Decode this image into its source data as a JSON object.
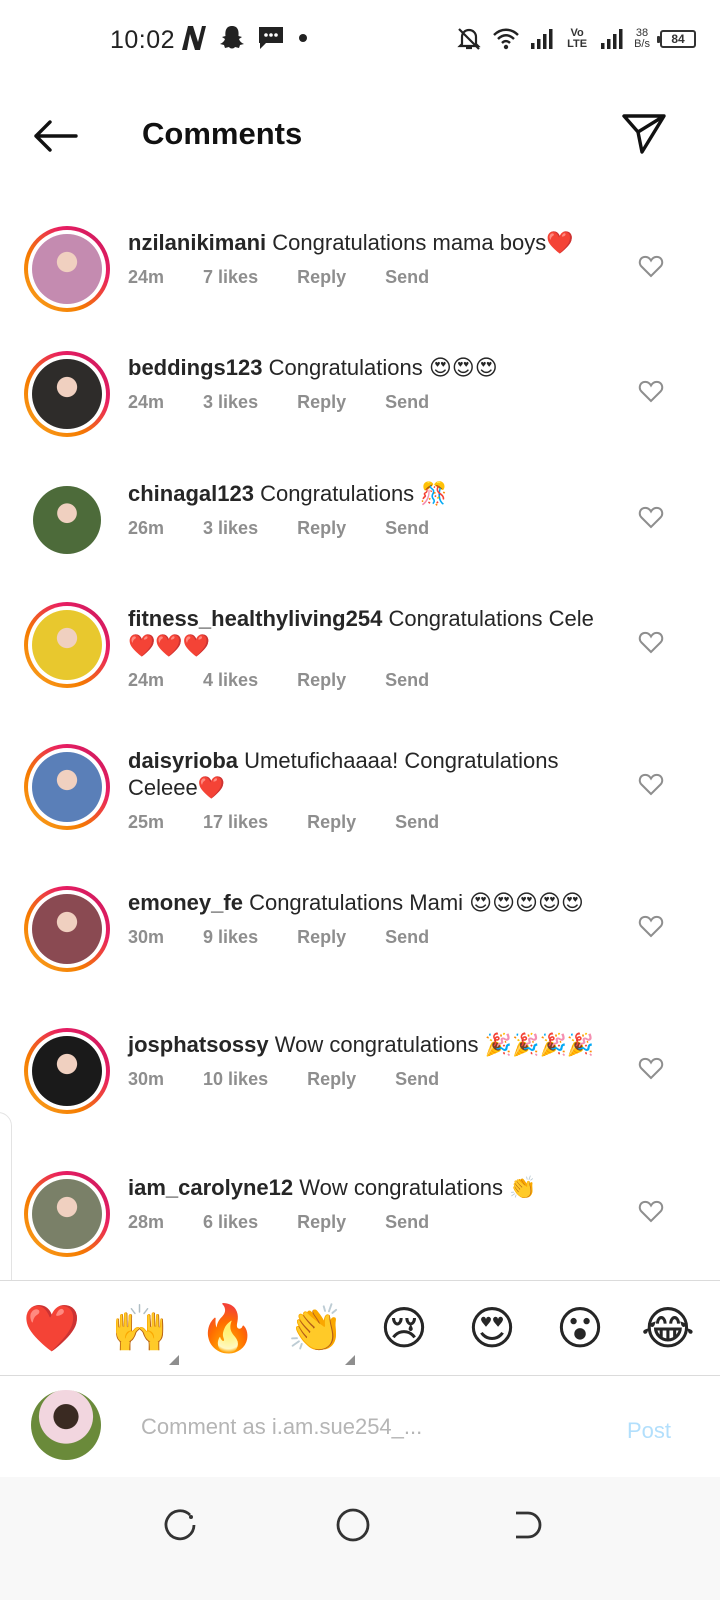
{
  "status_bar": {
    "time": "10:02",
    "net_speed_value": "38",
    "net_speed_unit": "B/s",
    "network_label": "Vo LTE",
    "battery": "84",
    "left_icons": [
      "netflix-icon",
      "snapchat-icon",
      "message-icon",
      "dot-icon"
    ],
    "right_icons": [
      "mute-bell-icon",
      "wifi-icon",
      "signal-icon",
      "signal-icon",
      "battery-icon"
    ]
  },
  "header": {
    "title": "Comments",
    "back_icon": "arrow-left-icon",
    "share_icon": "paper-plane-icon"
  },
  "comments": [
    {
      "username": "nzilanikimani",
      "text": "Congratulations mama boys❤️",
      "time": "24m",
      "likes": "7 likes",
      "reply": "Reply",
      "send": "Send",
      "story_ring": true,
      "avatar_color": "#c48bb0"
    },
    {
      "username": "beddings123",
      "text": "Congratulations 😍😍😍",
      "time": "24m",
      "likes": "3 likes",
      "reply": "Reply",
      "send": "Send",
      "story_ring": true,
      "avatar_color": "#2e2c2a"
    },
    {
      "username": "chinagal123",
      "text": "Congratulations 🎊",
      "time": "26m",
      "likes": "3 likes",
      "reply": "Reply",
      "send": "Send",
      "story_ring": false,
      "avatar_color": "#4d6b3a"
    },
    {
      "username": "fitness_healthyliving254",
      "text": "Congratulations Cele ❤️❤️❤️",
      "time": "24m",
      "likes": "4 likes",
      "reply": "Reply",
      "send": "Send",
      "story_ring": true,
      "avatar_color": "#e8c82e"
    },
    {
      "username": "daisyrioba",
      "text": "Umetufichaaaa! Congratulations Celeee❤️",
      "time": "25m",
      "likes": "17 likes",
      "reply": "Reply",
      "send": "Send",
      "story_ring": true,
      "avatar_color": "#5a7fb8"
    },
    {
      "username": "emoney_fe",
      "text": "Congratulations Mami 😍😍😍😍😍",
      "time": "30m",
      "likes": "9 likes",
      "reply": "Reply",
      "send": "Send",
      "story_ring": true,
      "avatar_color": "#8a4a52"
    },
    {
      "username": "josphatsossy",
      "text": "Wow congratulations 🎉🎉🎉🎉",
      "time": "30m",
      "likes": "10 likes",
      "reply": "Reply",
      "send": "Send",
      "story_ring": true,
      "avatar_color": "#1a1a1a"
    },
    {
      "username": "iam_carolyne12",
      "text": "Wow congratulations 👏",
      "time": "28m",
      "likes": "6 likes",
      "reply": "Reply",
      "send": "Send",
      "story_ring": true,
      "avatar_color": "#7a8068"
    }
  ],
  "emoji_bar": [
    {
      "glyph": "❤️",
      "name": "red-heart",
      "has_variants": false
    },
    {
      "glyph": "🙌",
      "name": "raising-hands",
      "has_variants": true
    },
    {
      "glyph": "🔥",
      "name": "fire",
      "has_variants": false
    },
    {
      "glyph": "👏",
      "name": "clapping-hands",
      "has_variants": true
    },
    {
      "glyph": "😢",
      "name": "crying-face",
      "has_variants": false
    },
    {
      "glyph": "😍",
      "name": "heart-eyes",
      "has_variants": false
    },
    {
      "glyph": "😮",
      "name": "surprised-face",
      "has_variants": false
    },
    {
      "glyph": "😂",
      "name": "laughing-tears",
      "has_variants": false
    }
  ],
  "comment_input": {
    "placeholder": "Comment as i.am.sue254_...",
    "value": "",
    "post_label": "Post"
  },
  "nav_bar": {
    "icons": [
      "recent-apps-icon",
      "home-icon",
      "back-icon"
    ]
  },
  "colors": {
    "text": "#262626",
    "meta": "#8e8e8e",
    "post_disabled": "#b2dffc",
    "story_ring_start": "#f9a825",
    "story_ring_end": "#c2185b"
  }
}
